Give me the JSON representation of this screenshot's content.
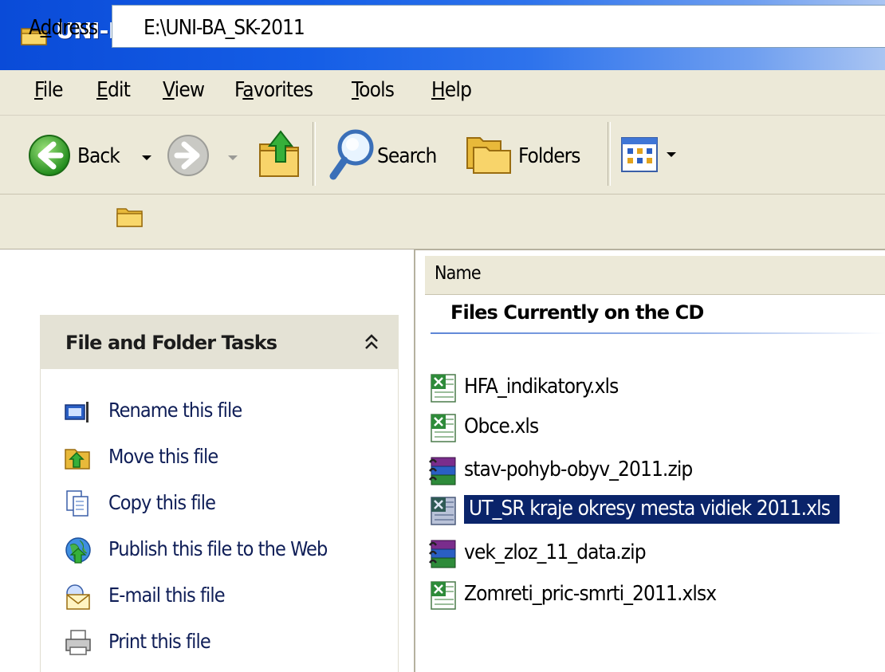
{
  "window": {
    "title": "UNI-BA_SK-2011"
  },
  "menu": {
    "items": [
      {
        "id": "file",
        "accel": "F",
        "rest": "ile"
      },
      {
        "id": "edit",
        "accel": "E",
        "rest": "dit"
      },
      {
        "id": "view",
        "accel": "V",
        "rest": "iew"
      },
      {
        "id": "favorites",
        "pre": "F",
        "accel": "a",
        "rest": "vorites"
      },
      {
        "id": "tools",
        "accel": "T",
        "rest": "ools"
      },
      {
        "id": "help",
        "accel": "H",
        "rest": "elp"
      }
    ]
  },
  "toolbar": {
    "back_label": "Back",
    "search_label": "Search",
    "folders_label": "Folders"
  },
  "address": {
    "label_accel": "d",
    "label_pre": "A",
    "label_rest": "dress",
    "value": "E:\\UNI-BA_SK-2011"
  },
  "tasks": {
    "title": "File and Folder Tasks",
    "items": [
      {
        "label": "Rename this file",
        "icon": "rename-icon"
      },
      {
        "label": "Move this file",
        "icon": "move-icon"
      },
      {
        "label": "Copy this file",
        "icon": "copy-icon"
      },
      {
        "label": "Publish this file to the Web",
        "icon": "globe-icon"
      },
      {
        "label": "E-mail this file",
        "icon": "email-icon"
      },
      {
        "label": "Print this file",
        "icon": "printer-icon"
      }
    ]
  },
  "files": {
    "column_name": "Name",
    "group_title": "Files Currently on the CD",
    "items": [
      {
        "name": "HFA_indikatory.xls",
        "type": "excel",
        "selected": false
      },
      {
        "name": "Obce.xls",
        "type": "excel",
        "selected": false
      },
      {
        "name": "stav-pohyb-obyv_2011.zip",
        "type": "rar",
        "selected": false
      },
      {
        "name": "UT_SR kraje okresy mesta vidiek 2011.xls",
        "type": "excel",
        "selected": true
      },
      {
        "name": "vek_zloz_11_data.zip",
        "type": "rar",
        "selected": false
      },
      {
        "name": "Zomreti_pric-smrti_2011.xlsx",
        "type": "excel",
        "selected": false
      }
    ]
  },
  "colors": {
    "titlebar": "#0a4bd8",
    "chrome": "#ece9d8",
    "selection": "#0a246a",
    "task_link": "#0f1e57"
  }
}
